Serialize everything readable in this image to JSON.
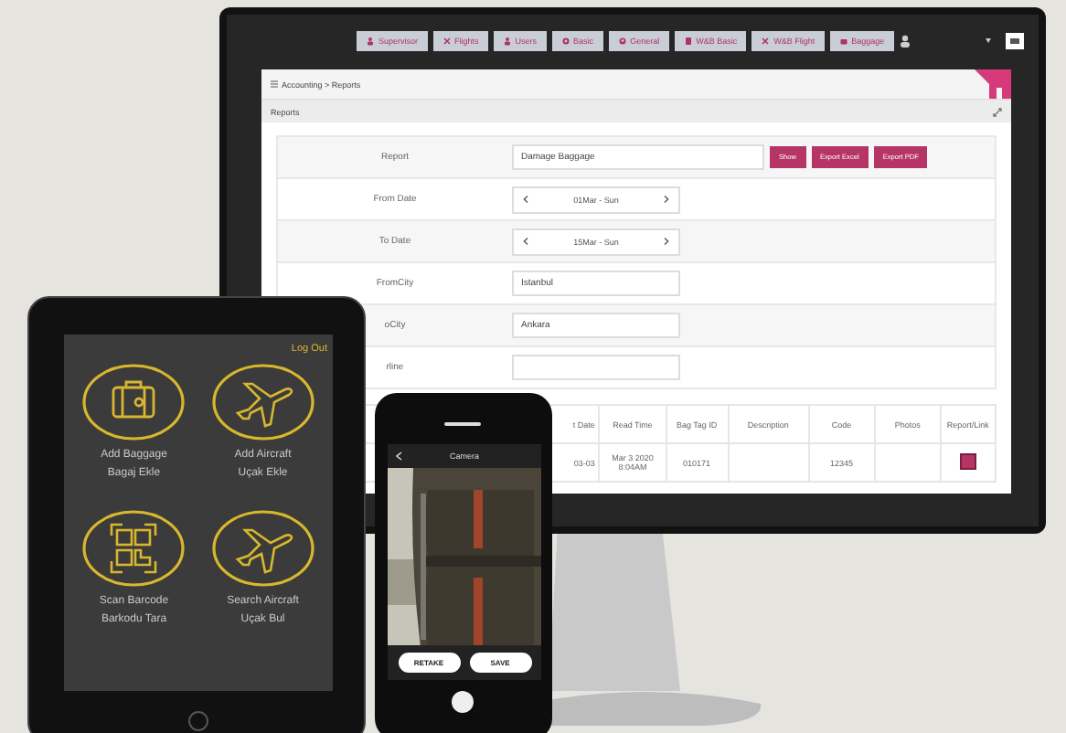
{
  "monitor": {
    "nav_tabs": [
      {
        "label": "Supervisor"
      },
      {
        "label": "Flights"
      },
      {
        "label": "Users"
      },
      {
        "label": "Basic"
      },
      {
        "label": "General"
      },
      {
        "label": "W&B Basic"
      },
      {
        "label": "W&B Flight"
      },
      {
        "label": "Baggage"
      }
    ],
    "breadcrumb": "Accounting > Reports",
    "panel_title": "Reports",
    "form": [
      {
        "label": "Report",
        "kind": "text",
        "value": "Damage Baggage"
      },
      {
        "label": "From Date",
        "kind": "date",
        "value": "01Mar - Sun"
      },
      {
        "label": "To Date",
        "kind": "date",
        "value": "15Mar - Sun"
      },
      {
        "label": "FromCity",
        "kind": "short",
        "value": "Istanbul"
      },
      {
        "label": "oCity",
        "kind": "short",
        "value": "Ankara"
      },
      {
        "label": "rline",
        "kind": "short"
      }
    ],
    "buttons": [
      "Show",
      "Export Excel",
      "Export PDF"
    ],
    "table": {
      "columns": [
        "t Date",
        "Read Time",
        "Bag Tag ID",
        "Description",
        "Code",
        "Photos",
        "Report/Link"
      ],
      "rows": [
        {
          "column_1": "03-03",
          "read_time": "Mar 3 2020 8:04AM",
          "bag_tag_id": "010171",
          "code": "12345",
          "report_link": true
        }
      ]
    }
  },
  "tablet": {
    "logout": "Log Out",
    "tiles": [
      {
        "kind": "baggage",
        "title": "Add Baggage",
        "subtitle": "Bagaj Ekle"
      },
      {
        "kind": "plane",
        "title": "Add Aircraft",
        "subtitle": "Uçak Ekle"
      },
      {
        "kind": "barcode",
        "title": "Scan Barcode",
        "subtitle": "Barkodu Tara"
      },
      {
        "kind": "plane",
        "title": "Search Aircraft",
        "subtitle": "Uçak Bul"
      }
    ]
  },
  "phone": {
    "title": "Camera",
    "buttons": [
      "RETAKE",
      "SAVE"
    ]
  }
}
